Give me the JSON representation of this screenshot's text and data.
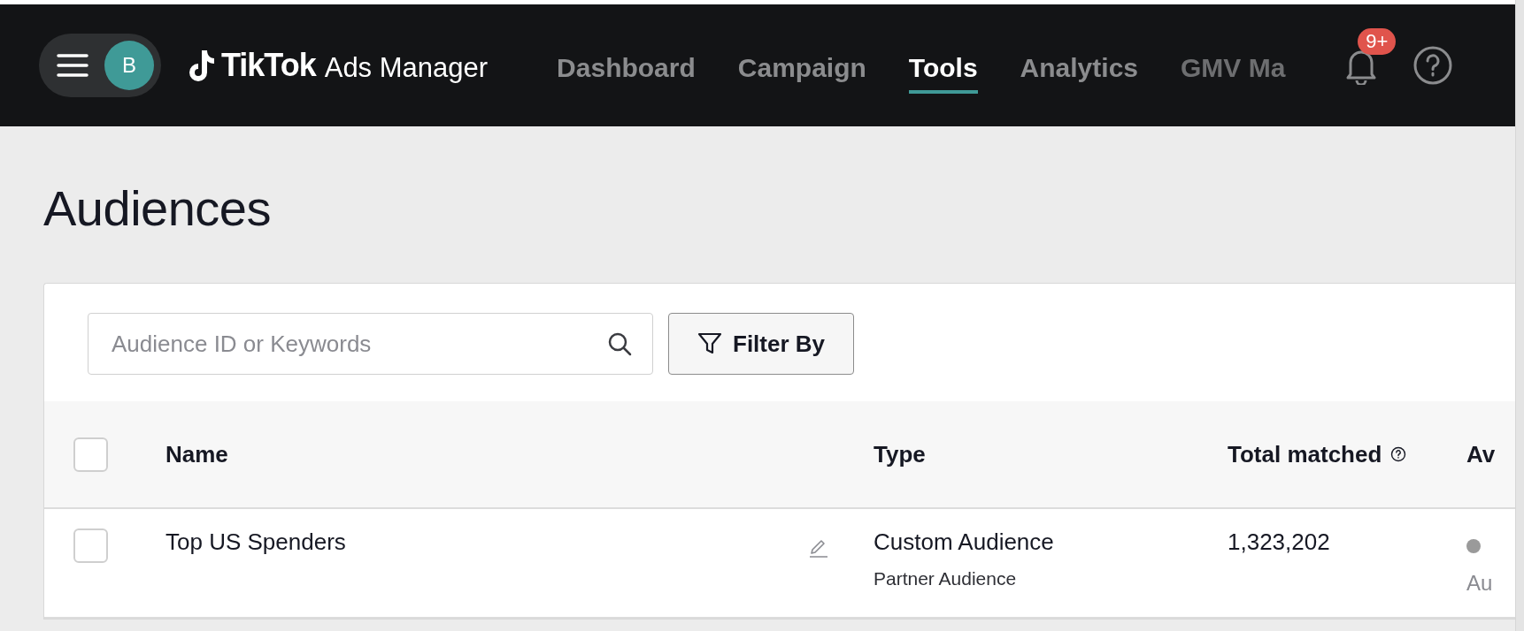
{
  "top_bar": {
    "avatar": "B",
    "logo": {
      "brand": "TikTok",
      "product": "Ads Manager"
    },
    "nav": [
      {
        "label": "Dashboard",
        "selected": false
      },
      {
        "label": "Campaign",
        "selected": false
      },
      {
        "label": "Tools",
        "selected": true
      },
      {
        "label": "Analytics",
        "selected": false
      },
      {
        "label": "GMV Ma",
        "selected": false,
        "faded": true
      }
    ],
    "notifications": {
      "badge": "9+"
    }
  },
  "page_title": "Audiences",
  "search": {
    "placeholder": "Audience ID or Keywords"
  },
  "filter_button": "Filter By",
  "table": {
    "select_all": {
      "checked": false
    },
    "columns": [
      "Name",
      "Type",
      "Total matched",
      "Av"
    ],
    "rows": [
      {
        "checked": false,
        "name": "Top US Spenders",
        "type": "Custom Audience",
        "subtype": "Partner Audience",
        "total_matched": "1,323,202",
        "status": {
          "color": "#9a9a9a",
          "text": "Au"
        }
      }
    ]
  }
}
